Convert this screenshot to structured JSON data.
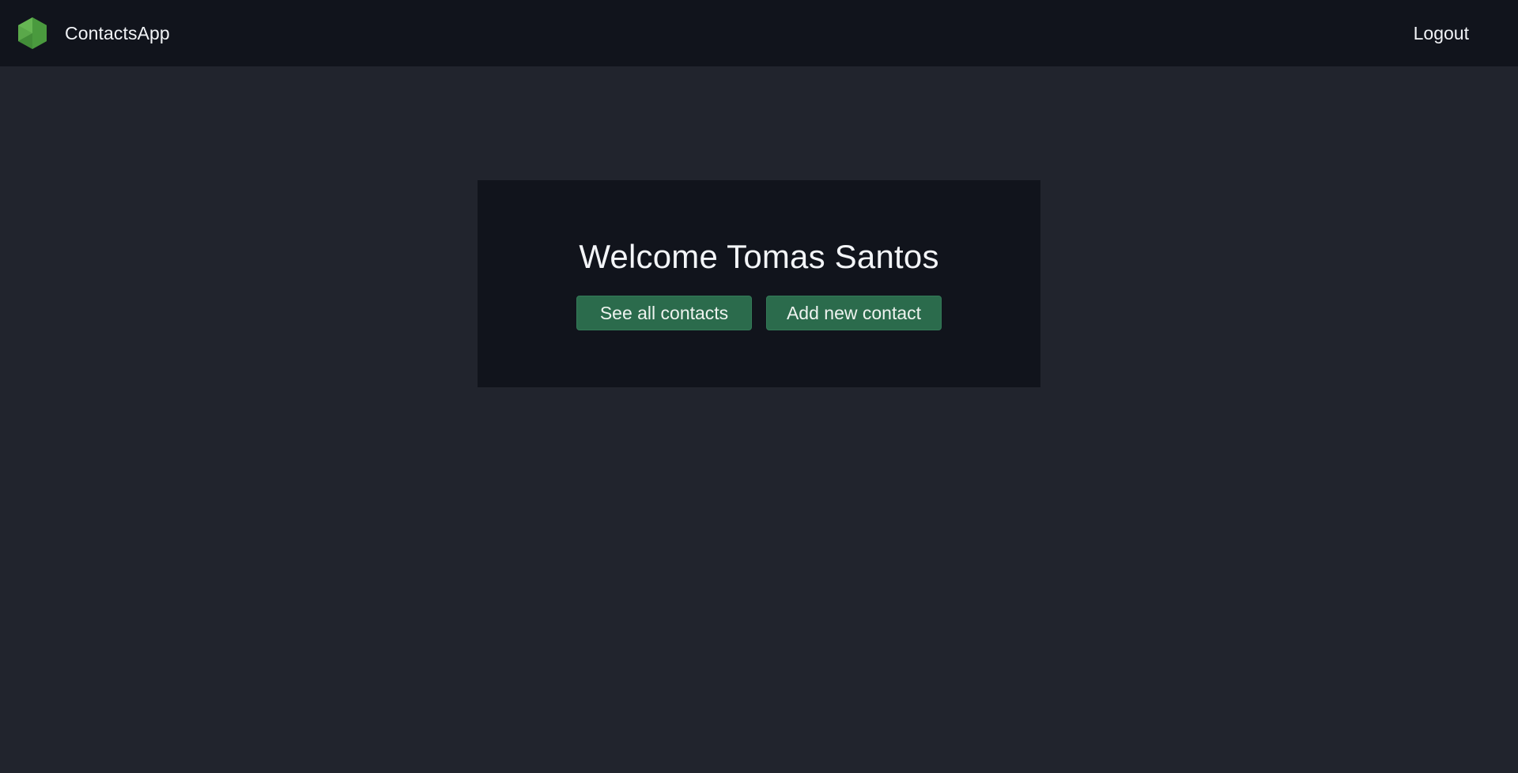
{
  "navbar": {
    "brand_name": "ContactsApp",
    "logo_icon": "green-hexagon-cube-icon",
    "logout_label": "Logout"
  },
  "main": {
    "welcome_title": "Welcome Tomas Santos",
    "buttons": [
      {
        "label": "See all contacts"
      },
      {
        "label": "Add new contact"
      }
    ]
  },
  "colors": {
    "background": "#21242d",
    "navbar_background": "#11141c",
    "card_background": "#11141c",
    "button_background": "#2b6b4c",
    "text": "#f1f3f6"
  }
}
